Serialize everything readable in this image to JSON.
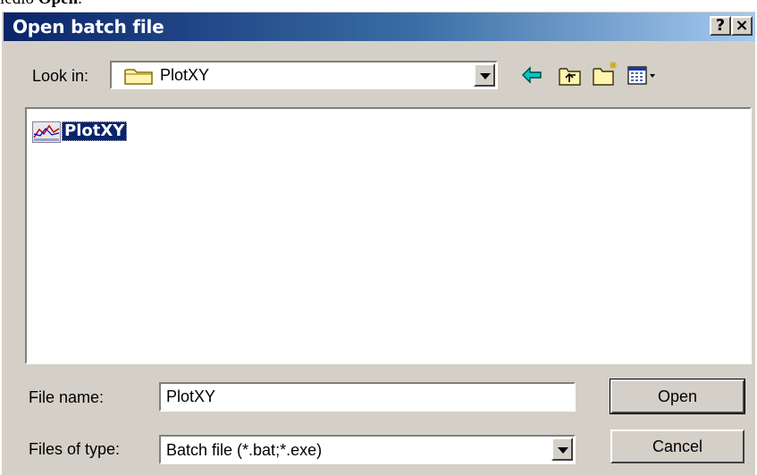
{
  "above_text": {
    "prefix": "ledio ",
    "bold": "Open",
    "suffix": "."
  },
  "window": {
    "title": "Open batch file",
    "help_label": "?",
    "close_label": "×"
  },
  "look_in": {
    "label": "Look in:",
    "value": "PlotXY"
  },
  "toolbar": {
    "icons": [
      "back-arrow-icon",
      "up-one-level-icon",
      "new-folder-icon",
      "view-menu-icon"
    ]
  },
  "file_list": {
    "items": [
      {
        "name": "PlotXY",
        "icon": "plotxy-app-icon",
        "selected": true
      }
    ]
  },
  "file_name": {
    "label": "File name:",
    "value": "PlotXY"
  },
  "file_type": {
    "label": "Files of type:",
    "value": "Batch file (*.bat;*.exe)"
  },
  "buttons": {
    "open": "Open",
    "cancel": "Cancel"
  },
  "colors": {
    "title_start": "#0a246a",
    "title_end": "#a6caf0",
    "face": "#d4d0c8",
    "selection": "#0a246a"
  }
}
